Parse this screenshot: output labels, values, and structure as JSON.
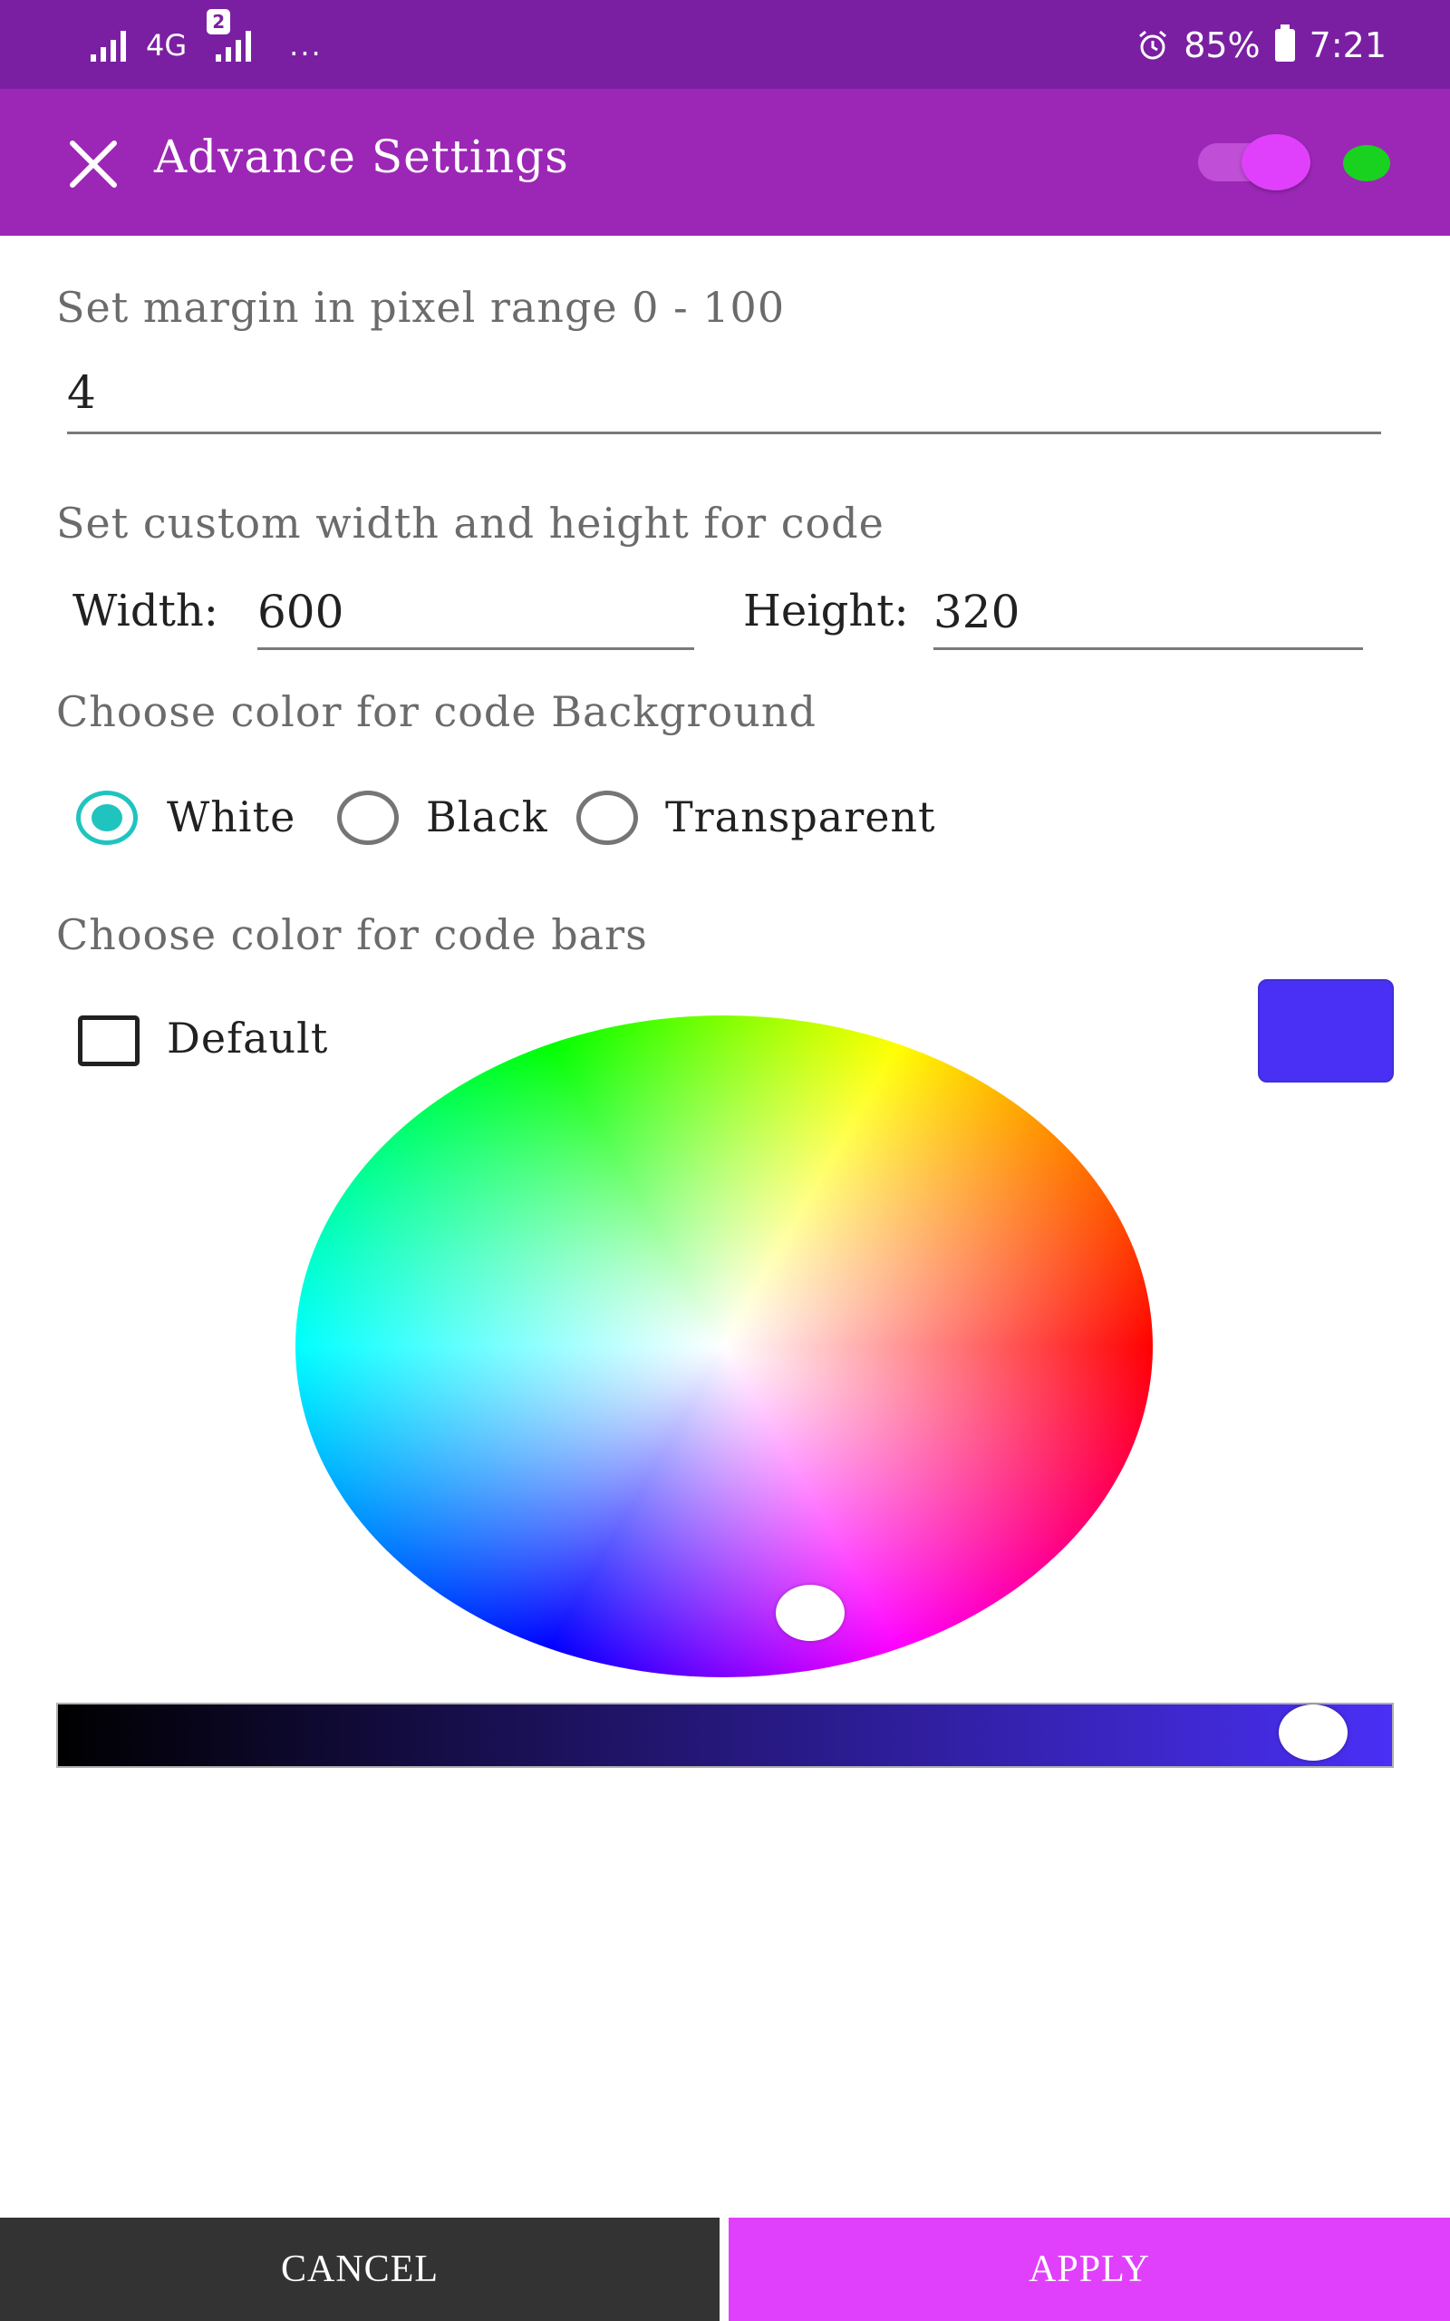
{
  "status_bar": {
    "network": "4G",
    "sim2_badge": "2",
    "more": "...",
    "battery": "85%",
    "time": "7:21"
  },
  "app_bar": {
    "title": "Advance Settings",
    "toggle_on": true,
    "accent": "#9c27b6",
    "toggle_color": "#e040fb",
    "indicator_color": "#19d21f"
  },
  "margin": {
    "label": "Set margin in pixel range 0 - 100",
    "value": "4"
  },
  "size": {
    "label": "Set custom width and height for code",
    "width_label": "Width:",
    "width_value": "600",
    "height_label": "Height:",
    "height_value": "320"
  },
  "background": {
    "label": "Choose color for code Background",
    "options": [
      "White",
      "Black",
      "Transparent"
    ],
    "selected": "White",
    "radio_color": "#1fc4bf"
  },
  "bars": {
    "label": "Choose color for code bars",
    "default_label": "Default",
    "default_checked": false,
    "selected_color": "#4a2ff5",
    "brightness": 0.94
  },
  "actions": {
    "cancel": "CANCEL",
    "apply": "APPLY"
  }
}
